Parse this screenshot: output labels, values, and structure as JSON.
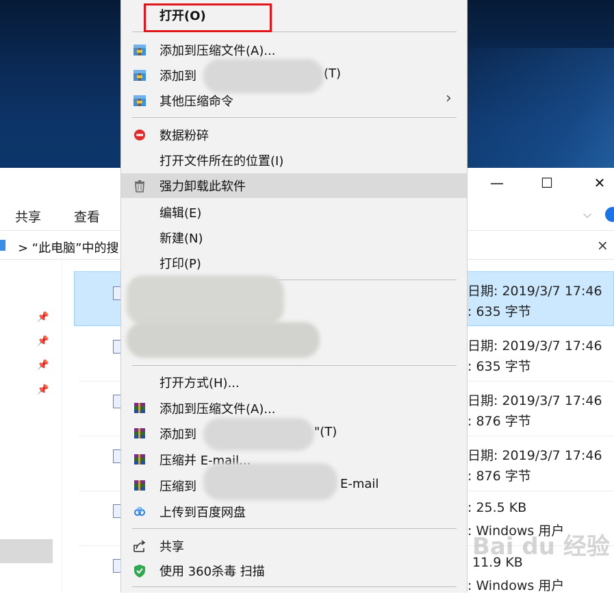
{
  "window": {
    "minimize": "—",
    "maximize": "☐",
    "close": "✕"
  },
  "ribbon": {
    "tab_share": "共享",
    "tab_view": "查看"
  },
  "address": {
    "text": "> “此电脑”中的搜",
    "close": "×"
  },
  "files": [
    {
      "date_label": "日期: 2019/3/7 17:46",
      "size_label": ": 635 字节",
      "selected": true
    },
    {
      "date_label": "日期: 2019/3/7 17:46",
      "size_label": ": 635 字节",
      "selected": false
    },
    {
      "date_label": "日期: 2019/3/7 17:46",
      "size_label": ": 876 字节",
      "selected": false
    },
    {
      "date_label": "日期: 2019/3/7 17:46",
      "size_label": ": 876 字节",
      "selected": false
    },
    {
      "date_label": ": 25.5 KB",
      "size_label": ": Windows 用户",
      "selected": false
    },
    {
      "date_label": "11.9 KB",
      "size_label": ": Windows 用户",
      "selected": false
    }
  ],
  "context_menu": {
    "open": "打开(O)",
    "add_archive": "添加到压缩文件(A)...",
    "add_to_prefix": "添加到",
    "add_to_suffix": "(T)",
    "other_compress": "其他压缩命令",
    "shred": "数据粉碎",
    "open_location": "打开文件所在的位置(I)",
    "force_uninstall": "强力卸载此软件",
    "edit": "编辑(E)",
    "new": "新建(N)",
    "print": "打印(P)",
    "open_with": "打开方式(H)...",
    "rar_add_archive": "添加到压缩文件(A)...",
    "rar_add_to_prefix": "添加到",
    "rar_add_to_suffix": "\"(T)",
    "compress_email": "压缩并 E-mail...",
    "compress_to_prefix": "压缩到",
    "compress_to_suffix": "E-mail",
    "upload_baidu": "上传到百度网盘",
    "share": "共享",
    "scan_360": "使用 360杀毒 扫描"
  },
  "watermark": "Bai du 经验",
  "colors": {
    "highlight_box": "#e1161b",
    "selection": "#cce8ff",
    "desktop": "#0b2a55"
  }
}
